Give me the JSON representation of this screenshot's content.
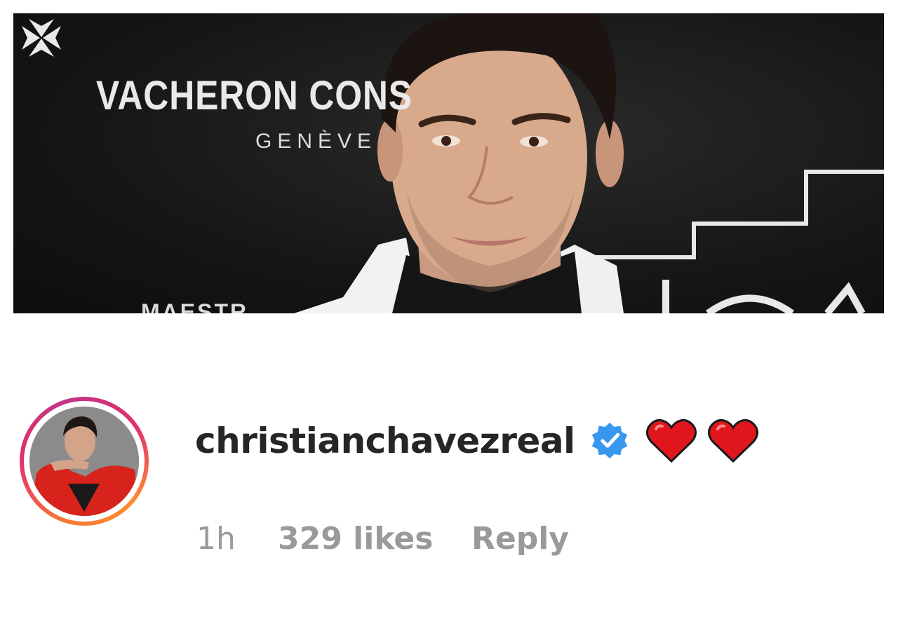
{
  "photo": {
    "brand_name": "VACHERON CONS",
    "brand_city": "GENÈVE",
    "brand_tag": "MAESTR"
  },
  "comment": {
    "username": "christianchavezreal",
    "verified_icon": "verified-badge-icon",
    "emoji": [
      "heart-icon",
      "heart-icon"
    ],
    "time": "1h",
    "likes": "329 likes",
    "reply_label": "Reply"
  },
  "colors": {
    "username": "#262626",
    "meta": "#9a9a9a",
    "verified": "#3897f0",
    "heart": "#e0161e",
    "ring_start": "#f77737",
    "ring_end": "#c13584"
  }
}
